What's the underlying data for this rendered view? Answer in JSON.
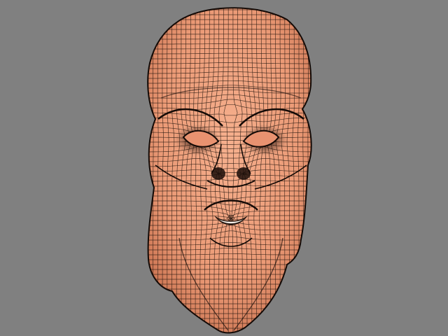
{
  "scene": {
    "background_color": "#808080",
    "model": {
      "subject": "creature-head-sculpt",
      "display_mode": "wireframe-on-shaded",
      "skin_color": "#f0a07c",
      "skin_shadow_color": "#c8714f",
      "wire_color": "#2a1a12",
      "crease_color": "#140a06",
      "teeth_color": "#f4f0ea"
    }
  }
}
